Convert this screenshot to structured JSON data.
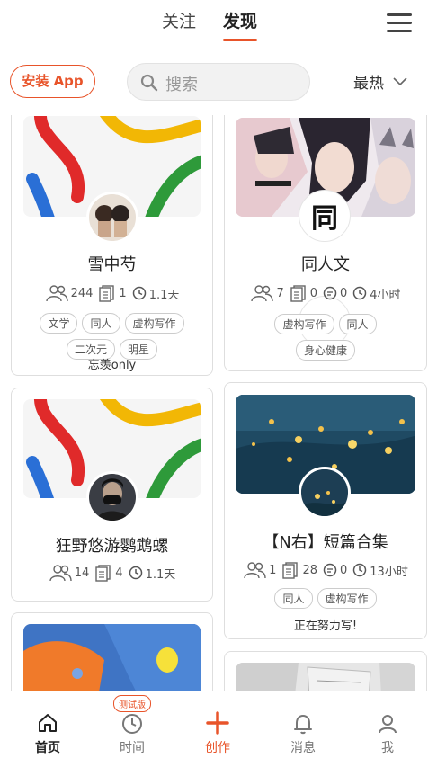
{
  "header": {
    "tabs": [
      {
        "label": "关注",
        "active": false
      },
      {
        "label": "发现",
        "active": true
      }
    ]
  },
  "toolbar": {
    "install_label": "安装 App",
    "search_placeholder": "搜索",
    "sort_label": "最热"
  },
  "colors": {
    "accent": "#e8542a",
    "cover_red": "#e02a2a",
    "cover_yellow": "#f2b705",
    "cover_blue": "#2a6fd6",
    "cover_green": "#2e9a3a"
  },
  "cards": [
    {
      "title": "雪中芍",
      "followers": "244",
      "posts": "1",
      "time": "1.1天",
      "tags": [
        "文学",
        "同人",
        "虚构写作",
        "二次元",
        "明星"
      ],
      "desc": "忘羡only"
    },
    {
      "title": "同人文",
      "avatar_text": "同",
      "followers": "7",
      "posts": "0",
      "comments": "0",
      "time": "4小时",
      "tags": [
        "虚构写作",
        "同人",
        "身心健康"
      ]
    },
    {
      "title": "狂野悠游鹦鹉螺",
      "followers": "14",
      "posts": "4",
      "time": "1.1天"
    },
    {
      "title": "【N右】短篇合集",
      "followers": "1",
      "posts": "28",
      "comments": "0",
      "time": "13小时",
      "tags": [
        "同人",
        "虚构写作"
      ],
      "desc": "正在努力写!"
    }
  ],
  "bottom_nav": {
    "home": "首页",
    "time": "时间",
    "time_badge": "测试版",
    "create": "创作",
    "messages": "消息",
    "me": "我"
  }
}
